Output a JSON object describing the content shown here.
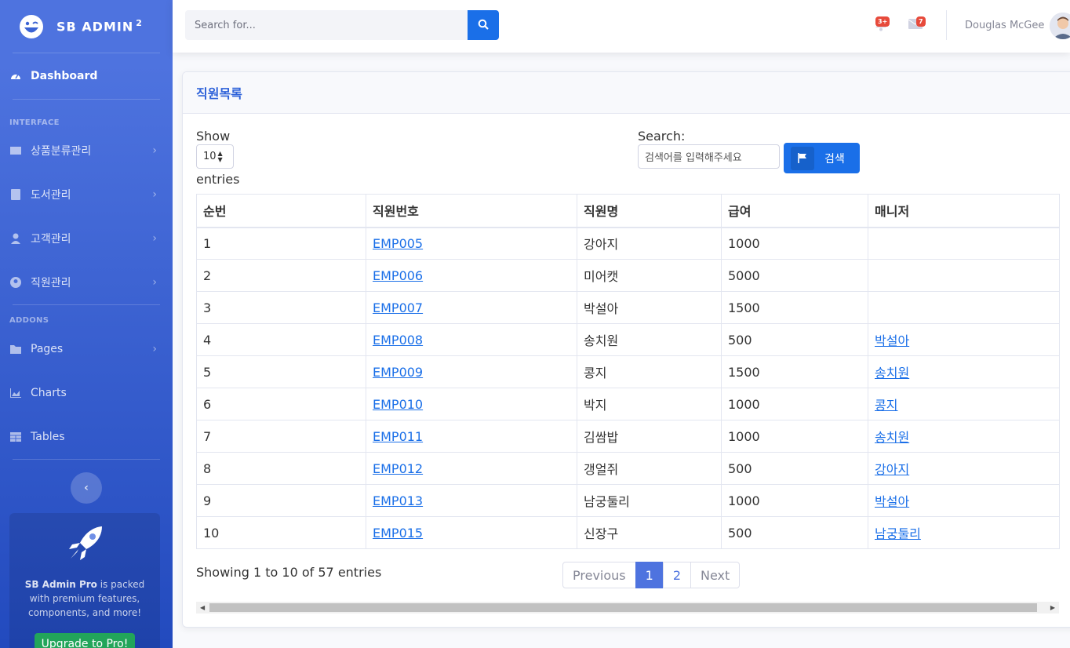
{
  "brand": {
    "name": "SB ADMIN",
    "sup": "2"
  },
  "sidebar": {
    "dashboard": "Dashboard",
    "heading_interface": "INTERFACE",
    "heading_addons": "ADDONS",
    "items": [
      {
        "label": "상품분류관리",
        "icon": "columns-icon"
      },
      {
        "label": "도서관리",
        "icon": "book-icon"
      },
      {
        "label": "고객관리",
        "icon": "user-icon"
      },
      {
        "label": "직원관리",
        "icon": "user-circle-icon"
      },
      {
        "label": "Pages",
        "icon": "folder-icon"
      },
      {
        "label": "Charts",
        "icon": "chart-area-icon"
      },
      {
        "label": "Tables",
        "icon": "table-icon"
      }
    ],
    "promo": {
      "title": "SB Admin Pro",
      "text": " is packed with premium features, components, and more!",
      "button": "Upgrade to Pro!"
    }
  },
  "topbar": {
    "search_placeholder": "Search for...",
    "alerts_badge": "3+",
    "messages_badge": "7",
    "user_name": "Douglas McGee"
  },
  "card": {
    "title": "직원목록",
    "show": "Show",
    "entries": "entries",
    "length_value": "10",
    "search_label": "Search:",
    "search_placeholder": "검색어를 입력해주세요",
    "search_button": "검색"
  },
  "table": {
    "headers": [
      "순번",
      "직원번호",
      "직원명",
      "급여",
      "매니저"
    ],
    "rows": [
      [
        "1",
        "EMP005",
        "강아지",
        "1000",
        ""
      ],
      [
        "2",
        "EMP006",
        "미어캣",
        "5000",
        ""
      ],
      [
        "3",
        "EMP007",
        "박설아",
        "1500",
        ""
      ],
      [
        "4",
        "EMP008",
        "송치원",
        "500",
        "박설아"
      ],
      [
        "5",
        "EMP009",
        "콩지",
        "1500",
        "송치원"
      ],
      [
        "6",
        "EMP010",
        "박지",
        "1000",
        "콩지"
      ],
      [
        "7",
        "EMP011",
        "김쌈밥",
        "1000",
        "송치원"
      ],
      [
        "8",
        "EMP012",
        "갱얼쥐",
        "500",
        "강아지"
      ],
      [
        "9",
        "EMP013",
        "남궁둘리",
        "1000",
        "박설아"
      ],
      [
        "10",
        "EMP015",
        "신장구",
        "500",
        "남궁둘리"
      ]
    ]
  },
  "footer": {
    "info": "Showing 1 to 10 of 57 entries",
    "previous": "Previous",
    "pages": [
      "1",
      "2"
    ],
    "next": "Next"
  }
}
